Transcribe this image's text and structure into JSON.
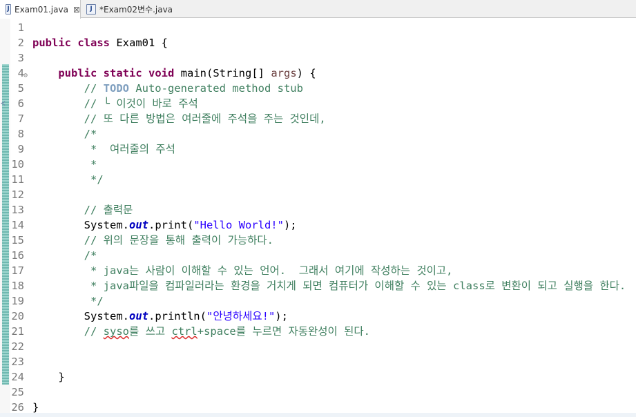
{
  "tabs": [
    {
      "label": "Exam01.java",
      "active": true,
      "close": "⊠"
    },
    {
      "label": "*Exam02변수.java",
      "active": false
    }
  ],
  "icons": {
    "java_file": "J",
    "fold": "⊖",
    "ruler_arrow": "≺"
  },
  "colors": {
    "keyword": "#7f0055",
    "comment": "#3f7f5f",
    "string": "#2a00ff",
    "field": "#0000c0",
    "todo": "#7f9fbf"
  },
  "lines": [
    {
      "n": "1",
      "t": []
    },
    {
      "n": "2",
      "t": [
        {
          "c": "kw",
          "s": "public"
        },
        {
          "c": "",
          "s": " "
        },
        {
          "c": "kw",
          "s": "class"
        },
        {
          "c": "",
          "s": " Exam01 {"
        }
      ]
    },
    {
      "n": "3",
      "t": []
    },
    {
      "n": "4",
      "fold": true,
      "t": [
        {
          "c": "",
          "s": "    "
        },
        {
          "c": "kw",
          "s": "public"
        },
        {
          "c": "",
          "s": " "
        },
        {
          "c": "kw",
          "s": "static"
        },
        {
          "c": "",
          "s": " "
        },
        {
          "c": "kw",
          "s": "void"
        },
        {
          "c": "",
          "s": " main(String[] "
        },
        {
          "c": "var",
          "s": "args"
        },
        {
          "c": "",
          "s": ") {"
        }
      ]
    },
    {
      "n": "5",
      "t": [
        {
          "c": "",
          "s": "        "
        },
        {
          "c": "cm",
          "s": "// "
        },
        {
          "c": "todo",
          "s": "TODO"
        },
        {
          "c": "cm",
          "s": " Auto-generated method stub"
        }
      ]
    },
    {
      "n": "6",
      "t": [
        {
          "c": "",
          "s": "        "
        },
        {
          "c": "cm",
          "s": "// └ 이것이 바로 주석"
        }
      ]
    },
    {
      "n": "7",
      "t": [
        {
          "c": "",
          "s": "        "
        },
        {
          "c": "cm",
          "s": "// 또 다른 방법은 여러줄에 주석을 주는 것인데,"
        }
      ]
    },
    {
      "n": "8",
      "t": [
        {
          "c": "",
          "s": "        "
        },
        {
          "c": "cm",
          "s": "/*"
        }
      ]
    },
    {
      "n": "9",
      "t": [
        {
          "c": "",
          "s": "        "
        },
        {
          "c": "cm",
          "s": " *  여러줄의 주석"
        }
      ]
    },
    {
      "n": "10",
      "t": [
        {
          "c": "",
          "s": "        "
        },
        {
          "c": "cm",
          "s": " *"
        }
      ]
    },
    {
      "n": "11",
      "t": [
        {
          "c": "",
          "s": "        "
        },
        {
          "c": "cm",
          "s": " */"
        }
      ]
    },
    {
      "n": "12",
      "t": []
    },
    {
      "n": "13",
      "t": [
        {
          "c": "",
          "s": "        "
        },
        {
          "c": "cm",
          "s": "// 출력문"
        }
      ]
    },
    {
      "n": "14",
      "t": [
        {
          "c": "",
          "s": "        System."
        },
        {
          "c": "fld",
          "s": "out"
        },
        {
          "c": "",
          "s": ".print("
        },
        {
          "c": "str",
          "s": "\"Hello World!\""
        },
        {
          "c": "",
          "s": ");"
        }
      ]
    },
    {
      "n": "15",
      "t": [
        {
          "c": "",
          "s": "        "
        },
        {
          "c": "cm",
          "s": "// 위의 문장을 통해 출력이 가능하다."
        }
      ]
    },
    {
      "n": "16",
      "t": [
        {
          "c": "",
          "s": "        "
        },
        {
          "c": "cm",
          "s": "/*"
        }
      ]
    },
    {
      "n": "17",
      "t": [
        {
          "c": "",
          "s": "        "
        },
        {
          "c": "cm",
          "s": " * java는 사람이 이해할 수 있는 언어.  그래서 여기에 작성하는 것이고,"
        }
      ]
    },
    {
      "n": "18",
      "t": [
        {
          "c": "",
          "s": "        "
        },
        {
          "c": "cm",
          "s": " * java파일을 컴파일러라는 환경을 거치게 되면 컴퓨터가 이해할 수 있는 class로 변환이 되고 실행을 한다."
        }
      ]
    },
    {
      "n": "19",
      "t": [
        {
          "c": "",
          "s": "        "
        },
        {
          "c": "cm",
          "s": " */"
        }
      ]
    },
    {
      "n": "20",
      "t": [
        {
          "c": "",
          "s": "        System."
        },
        {
          "c": "fld",
          "s": "out"
        },
        {
          "c": "",
          "s": ".println("
        },
        {
          "c": "str",
          "s": "\"안녕하세요!\""
        },
        {
          "c": "",
          "s": ");"
        }
      ]
    },
    {
      "n": "21",
      "t": [
        {
          "c": "",
          "s": "        "
        },
        {
          "c": "cm",
          "s": "// "
        },
        {
          "c": "cm squig",
          "s": "syso"
        },
        {
          "c": "cm",
          "s": "를 쓰고 "
        },
        {
          "c": "cm squig",
          "s": "ctrl"
        },
        {
          "c": "cm",
          "s": "+space를 누르면 자동완성이 된다."
        }
      ]
    },
    {
      "n": "22",
      "t": []
    },
    {
      "n": "23",
      "t": []
    },
    {
      "n": "24",
      "t": [
        {
          "c": "",
          "s": "    }"
        }
      ]
    },
    {
      "n": "25",
      "t": []
    },
    {
      "n": "26",
      "t": [
        {
          "c": "",
          "s": "}"
        }
      ]
    }
  ]
}
